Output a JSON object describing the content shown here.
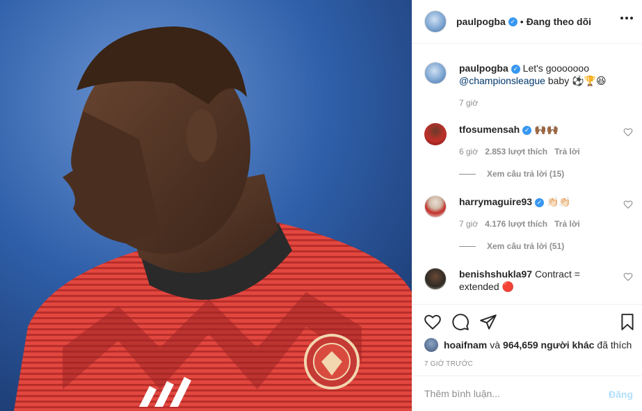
{
  "post": {
    "image_alt": "Player in red Manchester United warm-up shirt"
  },
  "header": {
    "username": "paulpogba",
    "verified_mark": "✓",
    "dot": "•",
    "follow_state": "Đang theo dõi",
    "more_icon": "more-horizontal-icon"
  },
  "caption": {
    "username": "paulpogba",
    "text_before": "Let's gooooooo",
    "mention": "@championsleague",
    "text_after": "baby ⚽️🏆😆",
    "time": "7 giờ"
  },
  "comments": [
    {
      "username": "tfosumensah",
      "text": "🙌🏾🙌🏾",
      "time": "6 giờ",
      "likes": "2.853 lượt thích",
      "reply": "Trả lời",
      "view_replies": "Xem câu trả lời (15)"
    },
    {
      "username": "harrymaguire93",
      "text": "👏🏻👏🏻",
      "time": "7 giờ",
      "likes": "4.176 lượt thích",
      "reply": "Trả lời",
      "view_replies": "Xem câu trả lời (51)"
    },
    {
      "username": "benishshukla97",
      "text": "Contract = extended 🔴"
    }
  ],
  "likes": {
    "user": "hoaifnam",
    "connector": "và",
    "count": "964,659 người khác",
    "suffix": "đã thích"
  },
  "timestamp": "7 GIỜ TRƯỚC",
  "add_comment": {
    "placeholder": "Thêm bình luận...",
    "post_label": "Đăng"
  },
  "icons": [
    "heart-icon",
    "comment-icon",
    "share-icon",
    "bookmark-icon"
  ],
  "colors": {
    "verified": "#3897f0",
    "link": "#00376b",
    "muted": "#8e8e8e",
    "post_disabled": "#b2dffc"
  }
}
